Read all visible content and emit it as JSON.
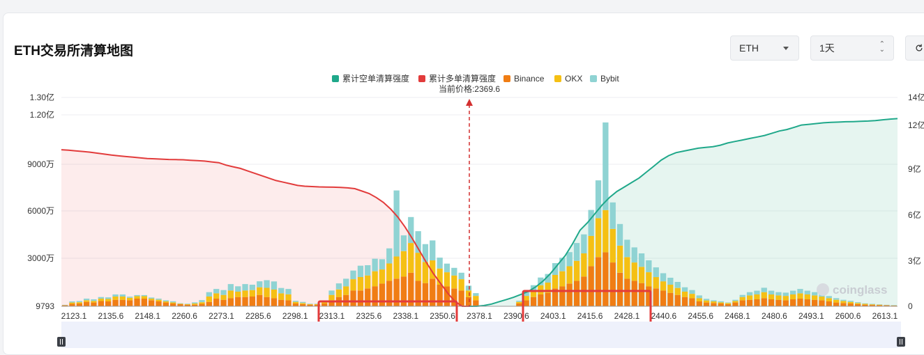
{
  "header": {
    "title": "ETH交易所清算地图",
    "coin_select": "ETH",
    "time_select": "1天"
  },
  "watermark": "coinglass",
  "colors": {
    "short_cum": "#1fa88a",
    "long_cum": "#e23b3b",
    "binance": "#f07d14",
    "okx": "#f5c014",
    "bybit": "#8fd3d3",
    "highlight": "#e33b3b"
  },
  "chart_data": {
    "type": "bar",
    "legend": [
      "累计空单清算强度",
      "累计多单清算强度",
      "Binance",
      "OKX",
      "Bybit"
    ],
    "legend_position": "top-center",
    "current_price_label": "当前价格:2369.6",
    "current_price": 2369.6,
    "y_left_ticks": [
      "9793",
      "3000万",
      "6000万",
      "9000万",
      "1.20亿",
      "1.30亿"
    ],
    "y_right_ticks": [
      "0",
      "3亿",
      "6亿",
      "9亿",
      "12亿",
      "14亿"
    ],
    "y_left_range_wan": [
      0,
      13000
    ],
    "y_right_range_yi": [
      0,
      14
    ],
    "x_tick_labels": [
      "2123.1",
      "2135.6",
      "2148.1",
      "2260.6",
      "2273.1",
      "2285.6",
      "2298.1",
      "2313.1",
      "2325.6",
      "2338.1",
      "2350.6",
      "2378.1",
      "2390.6",
      "2403.1",
      "2415.6",
      "2428.1",
      "2440.6",
      "2455.6",
      "2468.1",
      "2480.6",
      "2493.1",
      "2600.6",
      "2613.1"
    ],
    "bar_stack_order": [
      "Binance",
      "OKX",
      "Bybit"
    ],
    "binance": [
      60,
      150,
      170,
      270,
      230,
      320,
      300,
      400,
      400,
      370,
      470,
      470,
      370,
      300,
      230,
      170,
      130,
      100,
      100,
      150,
      270,
      470,
      400,
      500,
      570,
      570,
      600,
      700,
      570,
      500,
      400,
      370,
      170,
      130,
      100,
      100,
      170,
      370,
      570,
      700,
      970,
      970,
      1100,
      1230,
      1400,
      1570,
      1700,
      1830,
      2070,
      1570,
      1430,
      1700,
      1330,
      1230,
      1100,
      970,
      570,
      370,
      0,
      0,
      0,
      0,
      0,
      170,
      370,
      570,
      730,
      830,
      1100,
      1230,
      1400,
      1570,
      1830,
      2470,
      3030,
      3330,
      2700,
      2070,
      1700,
      1570,
      1430,
      1230,
      1100,
      970,
      830,
      700,
      570,
      500,
      300,
      230,
      200,
      170,
      130,
      230,
      370,
      400,
      430,
      500,
      430,
      400,
      370,
      430,
      470,
      430,
      400,
      370,
      300,
      230,
      200,
      170,
      130,
      100,
      80,
      70,
      60,
      50
    ],
    "okx": [
      20,
      80,
      80,
      100,
      100,
      150,
      150,
      200,
      200,
      150,
      150,
      150,
      100,
      100,
      70,
      70,
      30,
      30,
      70,
      100,
      330,
      330,
      300,
      470,
      330,
      400,
      400,
      470,
      570,
      530,
      400,
      370,
      100,
      70,
      30,
      30,
      70,
      330,
      470,
      530,
      700,
      830,
      800,
      930,
      870,
      1070,
      1370,
      1570,
      1830,
      1730,
      1300,
      1130,
      1000,
      870,
      800,
      700,
      400,
      270,
      0,
      0,
      0,
      0,
      0,
      100,
      270,
      400,
      570,
      630,
      830,
      930,
      1070,
      1230,
      1430,
      1870,
      2400,
      2600,
      2070,
      1670,
      1330,
      1130,
      1000,
      870,
      700,
      570,
      500,
      430,
      330,
      270,
      200,
      130,
      100,
      70,
      70,
      100,
      200,
      270,
      300,
      370,
      300,
      270,
      270,
      300,
      330,
      300,
      270,
      230,
      200,
      170,
      130,
      100,
      70,
      50,
      40,
      30,
      20,
      10
    ],
    "bybit": [
      10,
      70,
      70,
      100,
      100,
      100,
      100,
      130,
      130,
      70,
      70,
      70,
      70,
      70,
      70,
      70,
      30,
      30,
      70,
      130,
      270,
      270,
      300,
      400,
      330,
      400,
      330,
      370,
      470,
      500,
      330,
      330,
      70,
      70,
      30,
      30,
      70,
      270,
      370,
      470,
      530,
      700,
      630,
      770,
      630,
      930,
      4070,
      970,
      1600,
      1330,
      1100,
      1230,
      670,
      530,
      470,
      400,
      300,
      170,
      0,
      0,
      0,
      0,
      0,
      70,
      270,
      330,
      470,
      530,
      730,
      830,
      870,
      1100,
      1170,
      1600,
      2330,
      5400,
      1630,
      1330,
      1070,
      930,
      830,
      730,
      600,
      500,
      430,
      370,
      270,
      230,
      170,
      100,
      70,
      70,
      30,
      70,
      130,
      200,
      230,
      270,
      230,
      200,
      200,
      230,
      270,
      230,
      200,
      170,
      130,
      100,
      70,
      70,
      50,
      30,
      30,
      20,
      10,
      10
    ],
    "long_cum_wan": [
      9650,
      9620,
      9580,
      9540,
      9500,
      9440,
      9380,
      9320,
      9270,
      9230,
      9190,
      9150,
      9110,
      9090,
      9070,
      9050,
      9040,
      9030,
      9000,
      8980,
      8950,
      8900,
      8850,
      8700,
      8600,
      8500,
      8350,
      8200,
      8050,
      7900,
      7750,
      7650,
      7550,
      7450,
      7400,
      7380,
      7360,
      7350,
      7340,
      7330,
      7300,
      7250,
      7100,
      6950,
      6700,
      6400,
      6000,
      5500,
      4900,
      4200,
      3450,
      2700,
      2000,
      1400,
      800,
      300,
      0,
      0
    ],
    "short_cum_yi": [
      0,
      0,
      0.05,
      0.15,
      0.3,
      0.45,
      0.6,
      0.8,
      1.0,
      1.3,
      1.7,
      2.2,
      2.8,
      3.4,
      4.2,
      5.1,
      5.6,
      6.2,
      6.8,
      7.3,
      7.7,
      8.0,
      8.3,
      8.6,
      9.0,
      9.4,
      9.8,
      10.1,
      10.3,
      10.4,
      10.5,
      10.6,
      10.65,
      10.7,
      10.8,
      10.95,
      11.05,
      11.15,
      11.25,
      11.35,
      11.45,
      11.6,
      11.75,
      11.85,
      12.0,
      12.15,
      12.2,
      12.25,
      12.3,
      12.33,
      12.35,
      12.37,
      12.38,
      12.4,
      12.42,
      12.45,
      12.5,
      12.55,
      12.58
    ]
  }
}
